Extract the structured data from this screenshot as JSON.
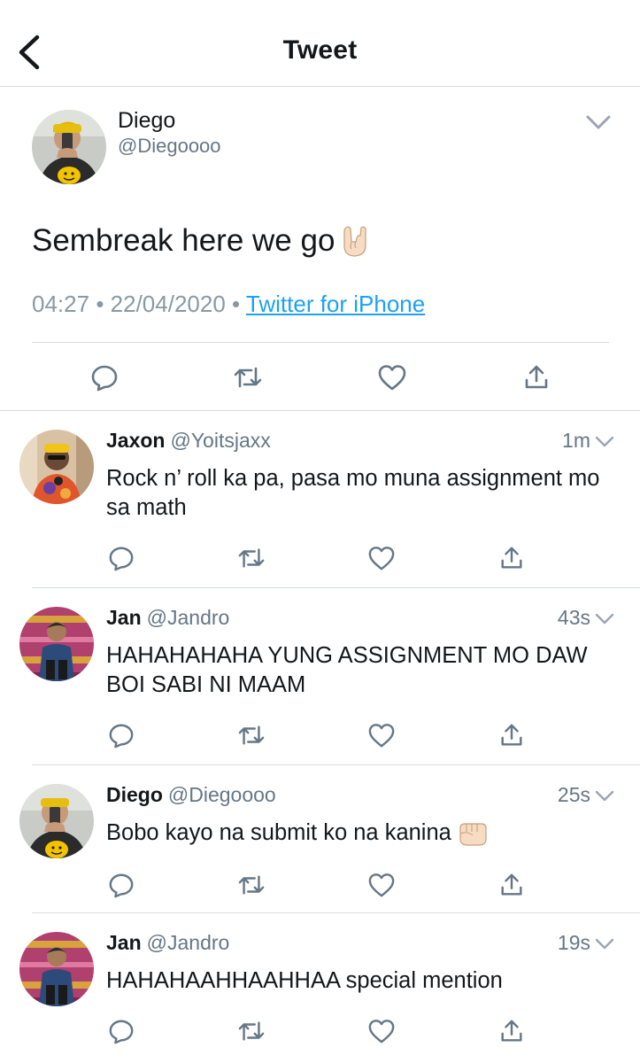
{
  "header": {
    "title": "Tweet"
  },
  "main_tweet": {
    "name": "Diego",
    "handle": "@Diegoooo",
    "text": "Sembreak here we go",
    "time": "04:27",
    "date": "22/04/2020",
    "source": "Twitter for iPhone",
    "separator": "•"
  },
  "replies": [
    {
      "name": "Jaxon",
      "handle": "@Yoitsjaxx",
      "time": "1m",
      "text": "Rock n’ roll ka pa, pasa mo muna assignment mo sa math"
    },
    {
      "name": "Jan",
      "handle": "@Jandro",
      "time": "43s",
      "text": "HAHAHAHAHA YUNG ASSIGNMENT MO DAW BOI SABI NI MAAM"
    },
    {
      "name": "Diego",
      "handle": "@Diegoooo",
      "time": "25s",
      "text": "Bobo kayo na submit ko na kanina"
    },
    {
      "name": "Jan",
      "handle": "@Jandro",
      "time": "19s",
      "text": "HAHAHAAHHAAHHAA special mention"
    }
  ],
  "colors": {
    "accent": "#1da1f2",
    "icon": "#657786",
    "divider": "#d7dbdf",
    "meta": "#8899a6"
  }
}
